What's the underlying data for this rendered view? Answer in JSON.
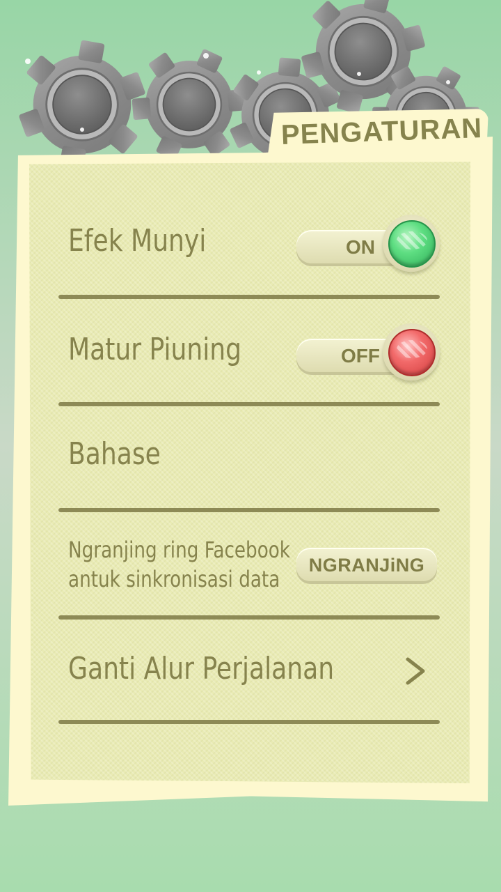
{
  "header": {
    "title": "PENGATURAN"
  },
  "settings": {
    "sound_effects": {
      "label": "Efek Munyi",
      "state": "ON",
      "enabled": true
    },
    "vibration": {
      "label": "Matur Piuning",
      "state": "OFF",
      "enabled": false
    },
    "language": {
      "label": "Bahase"
    },
    "facebook": {
      "line1": "Ngranjing ring Facebook",
      "line2": "antuk sinkronisasi data",
      "button_label": "NGRANJiNG"
    },
    "change_route": {
      "label": "Ganti Alur Perjalanan"
    }
  },
  "colors": {
    "text": "#86834d",
    "panel": "#fdf8cf",
    "on": "#3fc46a",
    "off": "#e25555"
  },
  "icons": [
    "gear-icon",
    "toggle-knob-on",
    "toggle-knob-off",
    "chevron-right-icon"
  ]
}
